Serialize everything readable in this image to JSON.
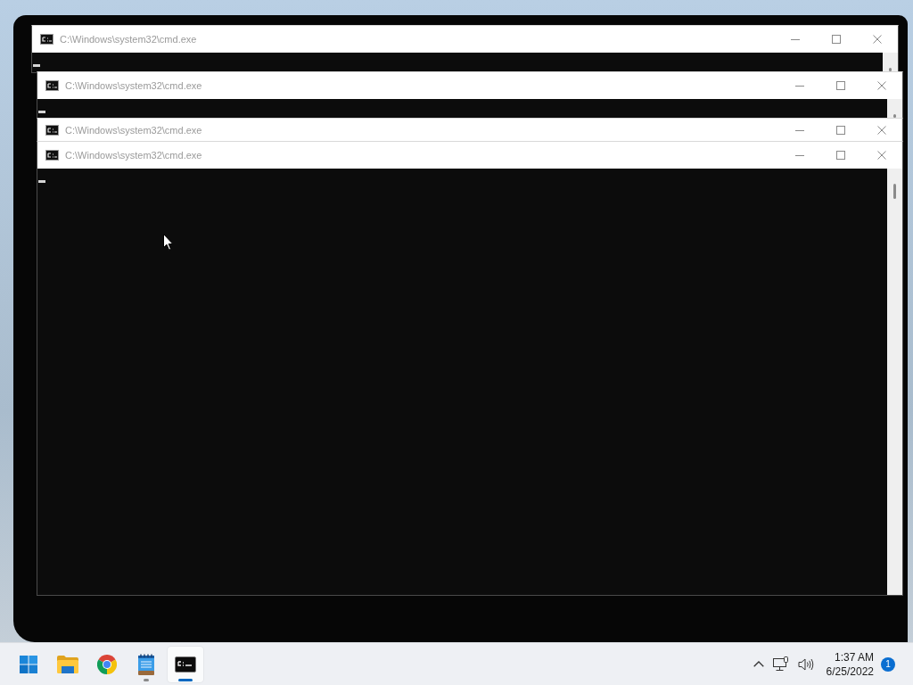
{
  "windows": [
    {
      "title": "C:\\Windows\\system32\\cmd.exe"
    },
    {
      "title": "C:\\Windows\\system32\\cmd.exe"
    },
    {
      "title": "C:\\Windows\\system32\\cmd.exe"
    },
    {
      "title": "C:\\Windows\\system32\\cmd.exe"
    }
  ],
  "taskbar": {
    "apps": [
      {
        "kind": "start",
        "open": false,
        "selected": false
      },
      {
        "kind": "explorer",
        "open": false,
        "selected": false
      },
      {
        "kind": "chrome",
        "open": false,
        "selected": false
      },
      {
        "kind": "notepad",
        "open": true,
        "selected": false
      },
      {
        "kind": "terminal",
        "open": true,
        "selected": true
      }
    ],
    "tray": {
      "clock": {
        "time": "1:37 AM",
        "date": "6/25/2022"
      },
      "notification_count": "1"
    }
  }
}
